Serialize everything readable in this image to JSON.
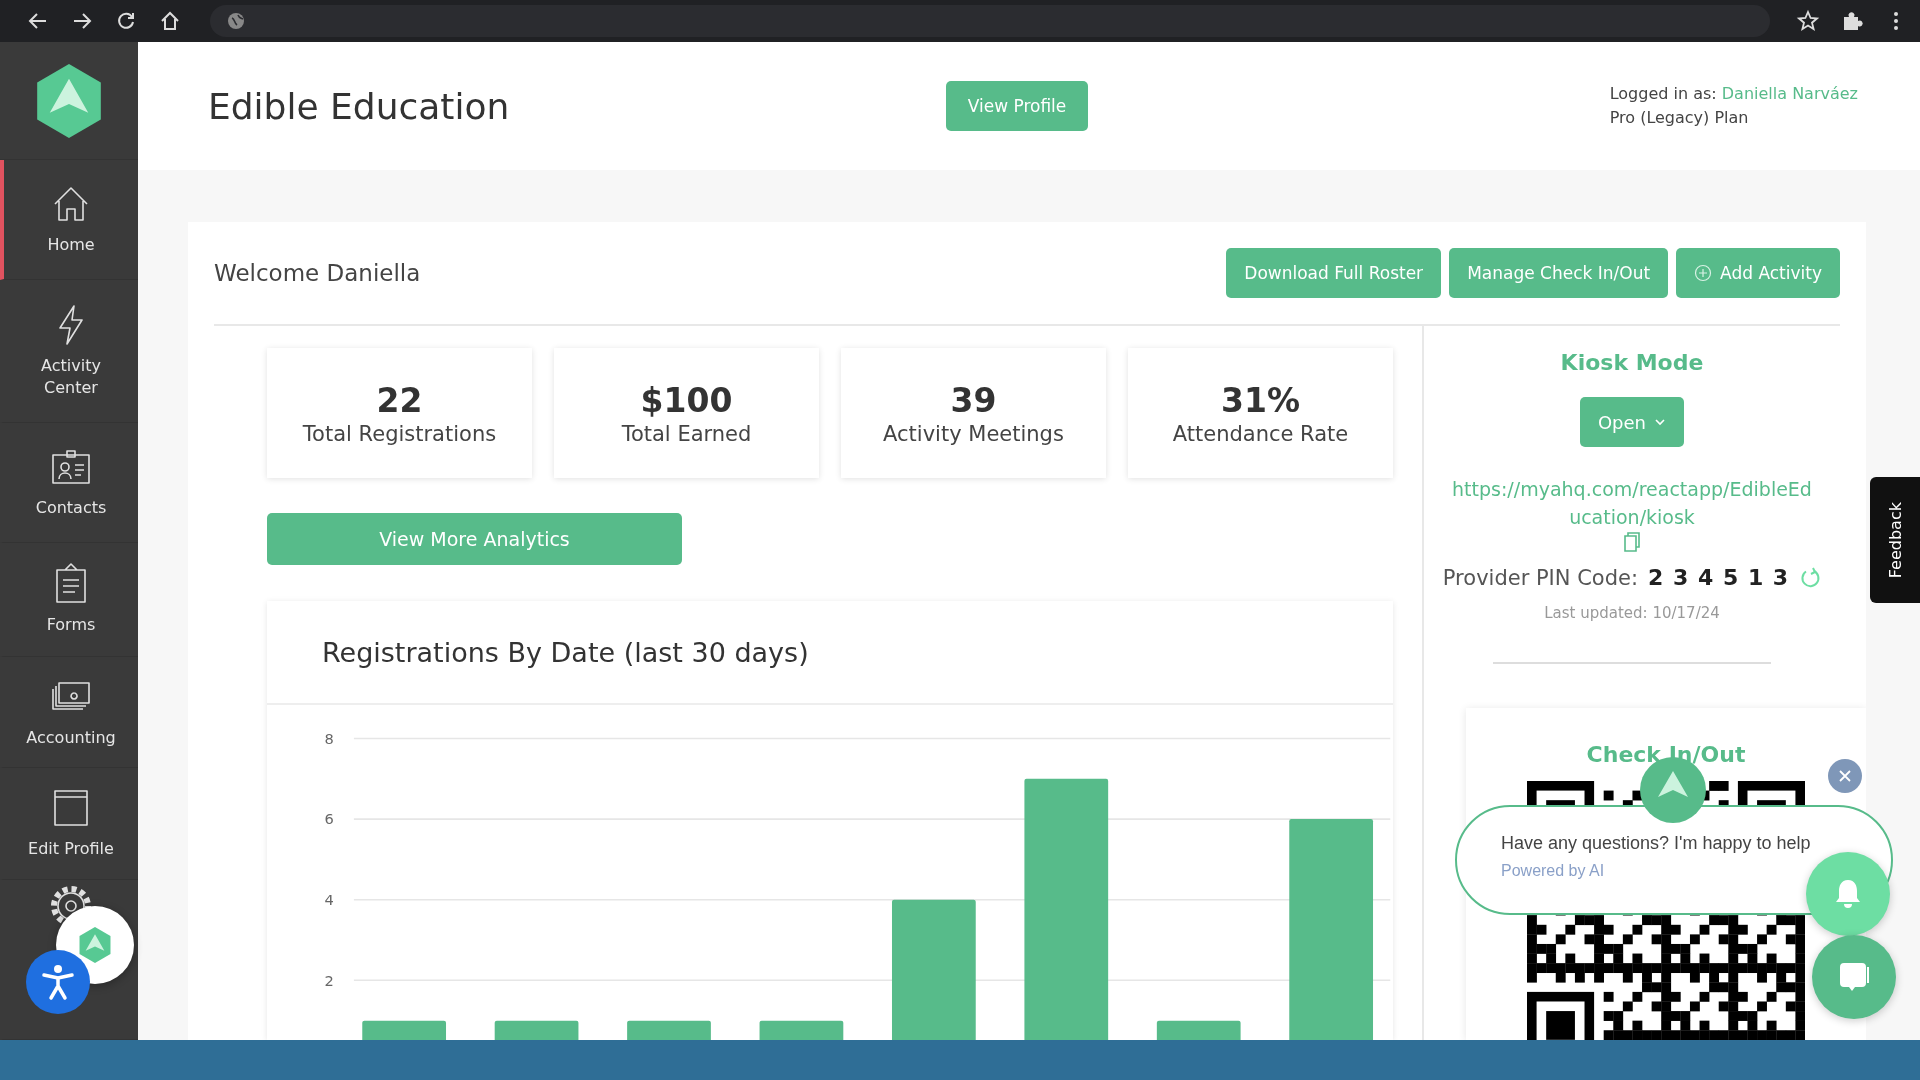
{
  "sidebar": {
    "items": [
      {
        "kind": "home",
        "label": "Home",
        "selected": true
      },
      {
        "kind": "bolt",
        "label": "Activity Center",
        "selected": false
      },
      {
        "kind": "contacts",
        "label": "Contacts",
        "selected": false
      },
      {
        "kind": "forms",
        "label": "Forms",
        "selected": false
      },
      {
        "kind": "accounting",
        "label": "Accounting",
        "selected": false
      },
      {
        "kind": "profile",
        "label": "Edit Profile",
        "selected": false
      },
      {
        "kind": "settings",
        "selected": false
      }
    ]
  },
  "header": {
    "title": "Edible Education",
    "button": "View Profile",
    "logged_in_label": "Logged in as:",
    "user": "Daniella Narváez",
    "plan": "Pro (Legacy) Plan"
  },
  "welcome": "Welcome Daniella",
  "actions": [
    {
      "kind": "plain",
      "label": "Download Full Roster"
    },
    {
      "kind": "plain",
      "label": "Manage Check In/Out"
    },
    {
      "kind": "add",
      "label": "Add Activity"
    }
  ],
  "stats": [
    {
      "value": "22",
      "label": "Total Registrations"
    },
    {
      "value": "$100",
      "label": "Total Earned"
    },
    {
      "value": "39",
      "label": "Activity Meetings"
    },
    {
      "value": "31%",
      "label": "Attendance Rate"
    }
  ],
  "analytics_button": "View More Analytics",
  "chart": {
    "title": "Registrations By Date (last 30 days)",
    "chart_data": {
      "type": "bar",
      "grid": true,
      "ylim": [
        0,
        8
      ],
      "yticks": [
        2,
        4,
        6,
        8
      ],
      "series": [
        {
          "color": "#57bb8a",
          "values": [
            1,
            1,
            1,
            1,
            4,
            7,
            1,
            6
          ]
        }
      ]
    }
  },
  "kiosk": {
    "title": "Kiosk Mode",
    "open_button": "Open",
    "url": "https://myahq.com/reactapp/EdibleEducation/kiosk",
    "pin_label": "Provider PIN Code:",
    "pin": "2 3 4 5 1 3",
    "updated": "Last updated: 10/17/24"
  },
  "checkin": {
    "title": "Check In/Out"
  },
  "chat": {
    "message": "Have any questions? I'm happy to help",
    "note": "Powered by AI"
  },
  "feedback": "Feedback"
}
